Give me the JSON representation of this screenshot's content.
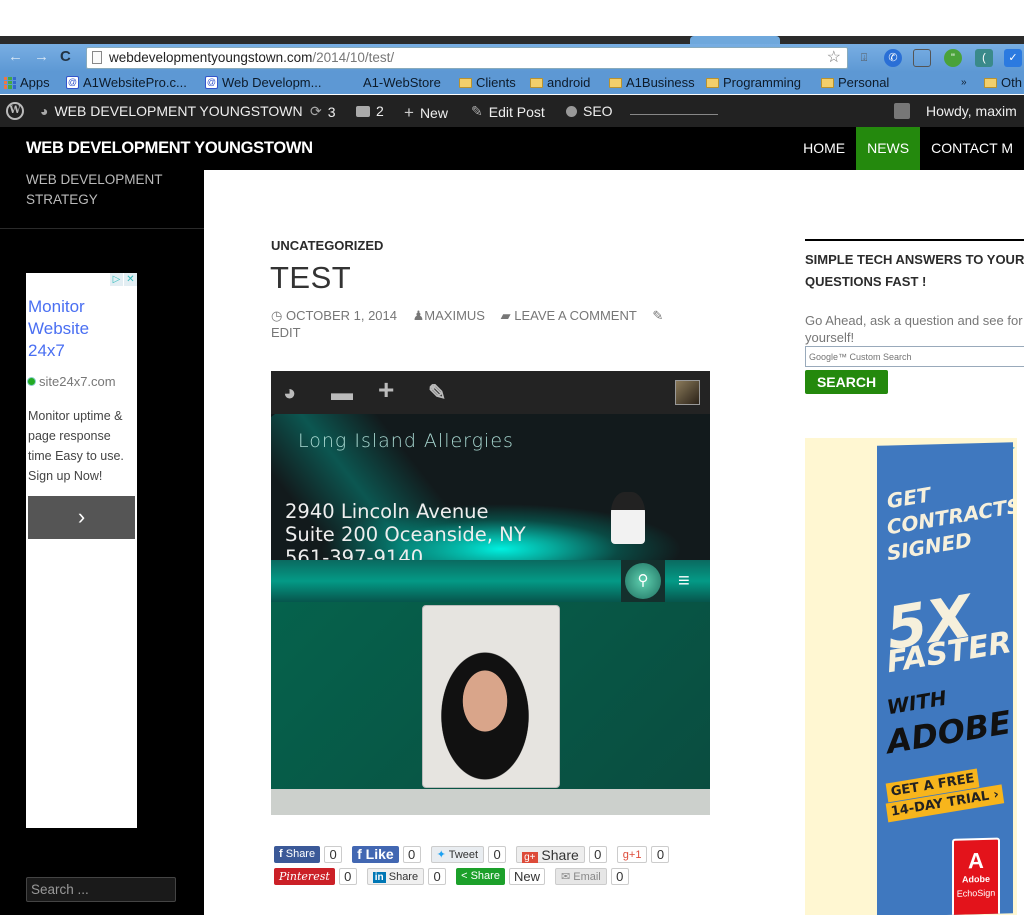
{
  "browser": {
    "url_host": "webdevelopmentyoungstown.com",
    "url_path": "/2014/10/test/",
    "nav": {
      "back": "←",
      "forward": "→",
      "reload": "C"
    },
    "extensions": [
      "download-icon",
      "phone-icon",
      "cast-icon",
      "hangouts-icon",
      "ext-icon",
      "check-icon"
    ],
    "bookmarks": [
      {
        "label": "Apps",
        "icon": "apps-icon"
      },
      {
        "label": "A1WebsitePro.c...",
        "icon": "site-icon"
      },
      {
        "label": "Web Developm...",
        "icon": "site-icon"
      },
      {
        "label": "A1-WebStore",
        "icon": "none"
      },
      {
        "label": "Clients",
        "icon": "folder-icon"
      },
      {
        "label": "android",
        "icon": "folder-icon"
      },
      {
        "label": "A1Business",
        "icon": "folder-icon"
      },
      {
        "label": "Programming",
        "icon": "folder-icon"
      },
      {
        "label": "Personal",
        "icon": "folder-icon"
      },
      {
        "label": "»",
        "icon": "none"
      },
      {
        "label": "Oth",
        "icon": "folder-icon"
      }
    ]
  },
  "adminbar": {
    "site_name": "WEB DEVELOPMENT YOUNGSTOWN",
    "updates": "3",
    "comments": "2",
    "new": "New",
    "edit_post": "Edit Post",
    "seo": "SEO",
    "howdy": "Howdy, maxim"
  },
  "site": {
    "title": "WEB DEVELOPMENT YOUNGSTOWN",
    "tagline": [
      "WEB DEVELOPMENT",
      "STRATEGY"
    ],
    "nav": [
      {
        "label": "HOME",
        "active": false
      },
      {
        "label": "NEWS",
        "active": true
      },
      {
        "label": "CONTACT M",
        "active": false
      }
    ]
  },
  "left_ad": {
    "title": [
      "Monitor",
      "Website",
      "24x7"
    ],
    "domain": "site24x7.com",
    "description": "Monitor uptime & page response time Easy to use. Sign up Now!",
    "button": "›"
  },
  "left_search": {
    "placeholder": "Search ..."
  },
  "post": {
    "category": "UNCATEGORIZED",
    "title": "TEST",
    "date": "OCTOBER 1, 2014",
    "author": "MAXIMUS",
    "comment_link": "LEAVE A COMMENT",
    "edit_link": "EDIT",
    "image": {
      "site_name": "Long Island Allergies",
      "address": [
        "2940 Lincoln Avenue",
        "Suite 200 Oceanside, NY",
        "561-397-9140"
      ]
    }
  },
  "share": {
    "row1": [
      {
        "label": "Share",
        "icon": "facebook-icon",
        "count": "0",
        "color": "#3b5998"
      },
      {
        "label": "Like",
        "icon": "facebook-icon",
        "count": "0",
        "color": "#4267b2"
      },
      {
        "label": "Tweet",
        "icon": "twitter-icon",
        "count": "0",
        "color": "#e9edf1"
      },
      {
        "label": "Share",
        "icon": "google-plus-icon",
        "count": "0",
        "color": "#dd4b39"
      },
      {
        "label": "+1",
        "icon": "google-plus-one-icon",
        "count": "0",
        "color": "#ffffff"
      }
    ],
    "row2": [
      {
        "label": "Pinterest",
        "icon": "pinterest-icon",
        "count": "0",
        "color": "#cb2027"
      },
      {
        "label": "Share",
        "icon": "linkedin-icon",
        "count": "0",
        "color": "#f0f0f0"
      },
      {
        "label": "Share",
        "icon": "share-icon",
        "count": "New",
        "color": "#1ca02a"
      },
      {
        "label": "Email",
        "icon": "email-icon",
        "count": "0",
        "color": "#e6e6e6"
      }
    ]
  },
  "right_widget": {
    "title": [
      "SIMPLE TECH ANSWERS TO YOUR",
      "QUESTIONS FAST !"
    ],
    "text": "Go Ahead, ask a question and see for yourself!",
    "search_placeholder": "Google™ Custom Search",
    "search_button": "SEARCH"
  },
  "right_ad": {
    "lines": [
      "GET",
      "CONTRACTS",
      "SIGNED",
      "5X",
      "FASTER",
      "WITH",
      "ADOBE"
    ],
    "cta": [
      "GET A FREE",
      "14-DAY TRIAL ›"
    ],
    "brand": "Adobe",
    "product": "EchoSign"
  },
  "colors": {
    "accent": "#24890d",
    "admin_bar": "#222222",
    "link_blue": "#4a6ff2"
  }
}
